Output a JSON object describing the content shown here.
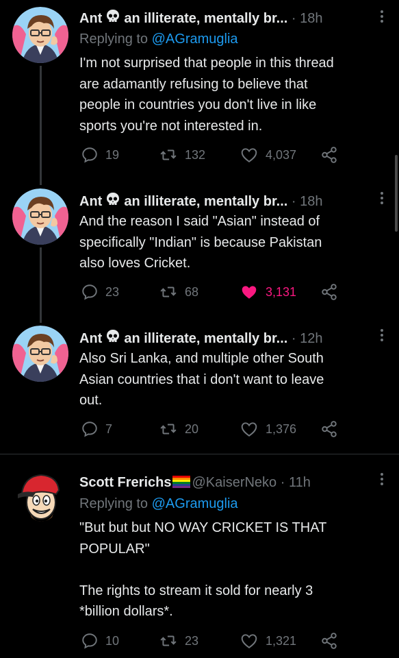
{
  "tweets": [
    {
      "name": "Ant",
      "display_suffix": "an illiterate, mentally br...",
      "time": "· 18h",
      "replying_prefix": "Replying to ",
      "replying_handle": "@AGramuglia",
      "body": "I'm not surprised that people in this thread\nare adamantly refusing to believe that\npeople in countries you don't live in like\nsports you're not interested in.",
      "replies": "19",
      "retweets": "132",
      "likes": "4,037"
    },
    {
      "name": "Ant",
      "display_suffix": "an illiterate, mentally br...",
      "time": "· 18h",
      "body": "And the reason I said \"Asian\" instead of\nspecifically \"Indian\" is because Pakistan\nalso loves Cricket.",
      "replies": "23",
      "retweets": "68",
      "likes": "3,131",
      "liked": true
    },
    {
      "name": "Ant",
      "display_suffix": "an illiterate, mentally br...",
      "time": "· 12h",
      "body": "Also Sri Lanka, and multiple other South\nAsian countries that i don't want to leave\nout.",
      "replies": "7",
      "retweets": "20",
      "likes": "1,376"
    },
    {
      "name": "Scott Frerichs",
      "handle": "@KaiserNeko",
      "time": "· 11h",
      "replying_prefix": "Replying to ",
      "replying_handle": "@AGramuglia",
      "body": "\"But but but NO WAY CRICKET IS THAT\nPOPULAR\"\n\nThe rights to stream it sold for nearly 3\n*billion dollars*.",
      "replies": "10",
      "retweets": "23",
      "likes": "1,321"
    }
  ],
  "colors": {
    "background": "#000000",
    "text": "#e7e9ea",
    "muted": "#71767b",
    "link": "#1d9bf0",
    "like": "#f91880"
  },
  "icons": [
    "reply-icon",
    "retweet-icon",
    "like-icon",
    "share-icon",
    "more-icon",
    "skull-icon",
    "pride-flag-icon"
  ]
}
